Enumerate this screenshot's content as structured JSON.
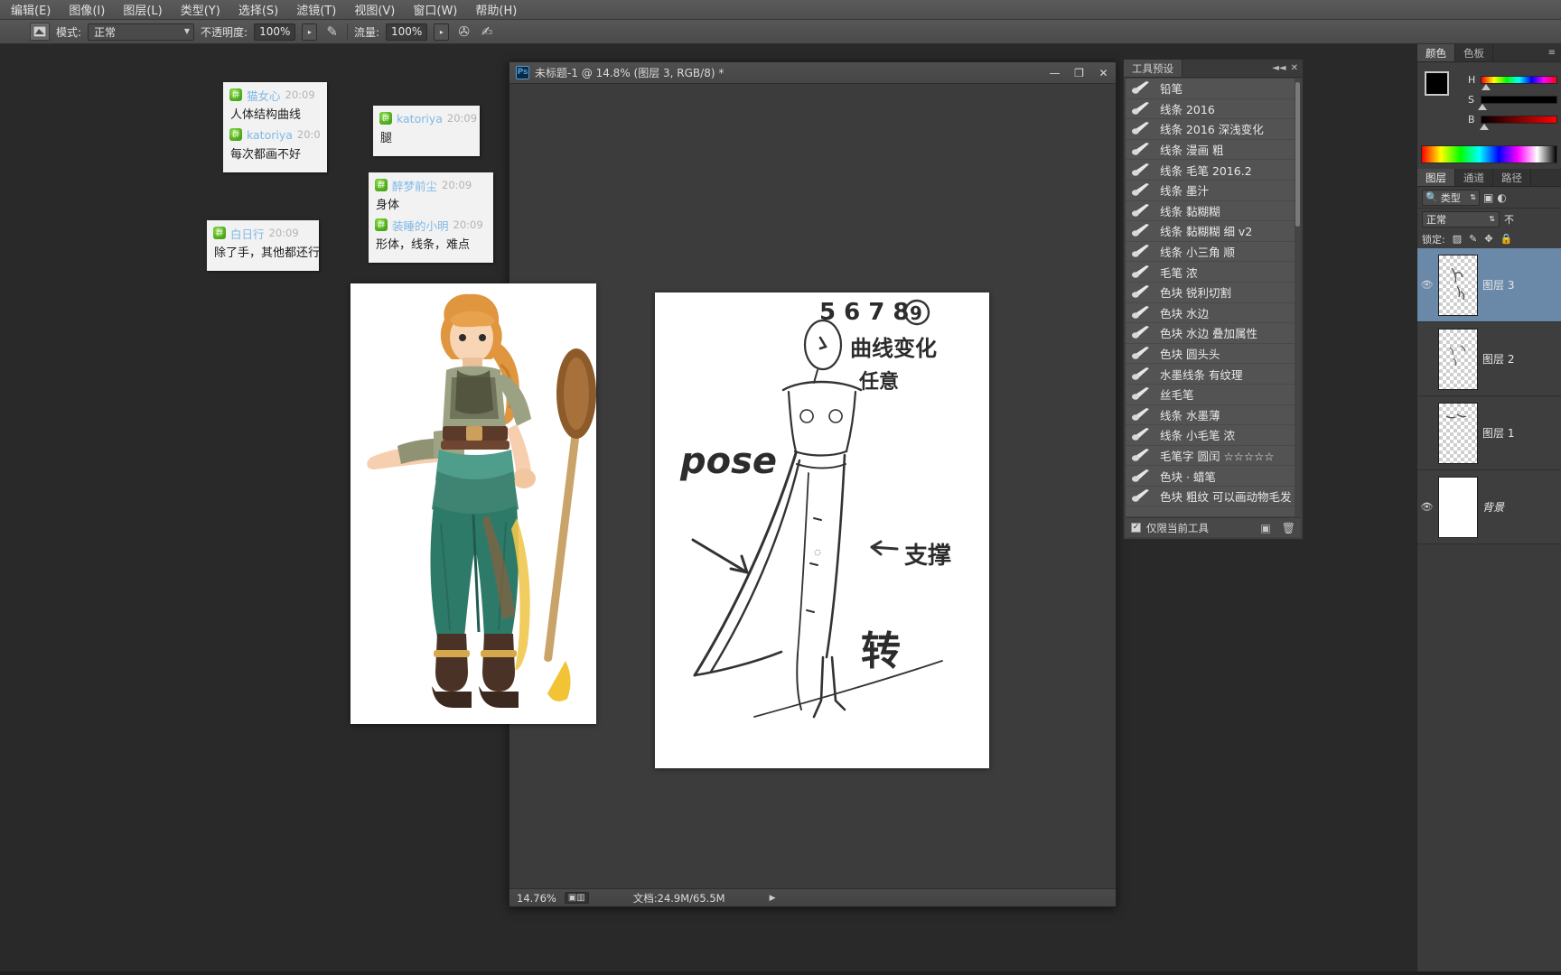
{
  "menubar": {
    "items": [
      {
        "label": "编辑(E)"
      },
      {
        "label": "图像(I)"
      },
      {
        "label": "图层(L)"
      },
      {
        "label": "类型(Y)"
      },
      {
        "label": "选择(S)"
      },
      {
        "label": "滤镜(T)"
      },
      {
        "label": "视图(V)"
      },
      {
        "label": "窗口(W)"
      },
      {
        "label": "帮助(H)"
      }
    ]
  },
  "options_bar": {
    "tool_icon": "brush-preset-icon",
    "mode_label": "模式:",
    "mode_value": "正常",
    "opacity_label": "不透明度:",
    "opacity_value": "100%",
    "airbrush_icon": "airbrush-icon",
    "flow_label": "流量:",
    "flow_value": "100%",
    "smoothing_icon": "smoothing-icon",
    "tablet_icon": "tablet-pressure-icon"
  },
  "chat": {
    "bubbles": [
      {
        "id": "bubble-1",
        "messages": [
          {
            "avatar": "group-avatar",
            "name": "猫女心",
            "time": "20:09",
            "text": "人体结构曲线"
          },
          {
            "avatar": "group-avatar",
            "name": "katoriya",
            "time": "20:0",
            "text": "每次都画不好"
          }
        ]
      },
      {
        "id": "bubble-2",
        "messages": [
          {
            "avatar": "group-avatar",
            "name": "katoriya",
            "time": "20:09",
            "text": "腿"
          }
        ]
      },
      {
        "id": "bubble-3",
        "messages": [
          {
            "avatar": "group-avatar",
            "name": "醉梦前尘",
            "time": "20:09",
            "text": "身体"
          },
          {
            "avatar": "group-avatar",
            "name": "装睡的小明",
            "time": "20:09",
            "text": "形体，线条，难点"
          }
        ]
      },
      {
        "id": "bubble-4",
        "messages": [
          {
            "avatar": "group-avatar",
            "name": "白日行",
            "time": "20:09",
            "text": "除了手，其他都还行"
          }
        ]
      }
    ]
  },
  "document_window": {
    "app_badge": "Ps",
    "title": "未标题-1 @ 14.8% (图层 3, RGB/8) *",
    "minimize_icon": "minimize-icon",
    "maximize_icon": "maximize-icon",
    "close_icon": "close-icon",
    "status": {
      "zoom": "14.76%",
      "doc_icon": "document-dimensions-icon",
      "doc_label": "文档:24.9M/65.5M",
      "more_icon": "status-more-arrow"
    }
  },
  "artwork": {
    "character_illustration": "character-illustration",
    "sketch_canvas": "pose-sketch-canvas",
    "sketch_annotations": [
      "5678 9",
      "曲线 变化",
      "任意",
      "pose",
      "支撑",
      "转"
    ]
  },
  "tool_presets_panel": {
    "tab_label": "工具预设",
    "collapse_icon": "collapse-icon",
    "close_icon": "close-icon",
    "menu_icon": "panel-menu-icon",
    "items": [
      {
        "icon": "brush-icon",
        "label": "铅笔"
      },
      {
        "icon": "brush-icon",
        "label": "线条 2016"
      },
      {
        "icon": "brush-icon",
        "label": "线条 2016 深浅变化"
      },
      {
        "icon": "brush-icon",
        "label": "线条 漫画 粗"
      },
      {
        "icon": "brush-icon",
        "label": "线条 毛笔 2016.2"
      },
      {
        "icon": "brush-icon",
        "label": "线条 墨汁"
      },
      {
        "icon": "brush-icon",
        "label": "线条 黏糊糊"
      },
      {
        "icon": "brush-icon",
        "label": "线条 黏糊糊 细 v2"
      },
      {
        "icon": "brush-icon",
        "label": "线条 小三角 顺"
      },
      {
        "icon": "brush-icon",
        "label": "毛笔 浓"
      },
      {
        "icon": "brush-icon",
        "label": "色块 锐利切割"
      },
      {
        "icon": "brush-icon",
        "label": "色块 水边"
      },
      {
        "icon": "brush-icon",
        "label": "色块 水边 叠加属性"
      },
      {
        "icon": "brush-icon",
        "label": "色块 圆头头"
      },
      {
        "icon": "brush-icon",
        "label": "水墨线条 有纹理"
      },
      {
        "icon": "brush-icon",
        "label": "丝毛笔"
      },
      {
        "icon": "brush-icon",
        "label": "线条 水墨薄"
      },
      {
        "icon": "brush-icon",
        "label": "线条 小毛笔 浓"
      },
      {
        "icon": "brush-icon",
        "label": "毛笔字 圆闰 ☆☆☆☆☆"
      },
      {
        "icon": "brush-icon",
        "label": "色块 · 蜡笔"
      },
      {
        "icon": "brush-icon",
        "label": "色块 粗纹 可以画动物毛发"
      }
    ],
    "footer": {
      "checkbox_checked": "✓",
      "checkbox_label": "仅限当前工具",
      "new_preset_icon": "new-preset-icon",
      "delete_icon": "trash-icon"
    }
  },
  "color_panel": {
    "tabs": [
      {
        "label": "颜色",
        "active": true
      },
      {
        "label": "色板",
        "active": false
      }
    ],
    "foreground_color": "#000000",
    "background_color": "#c8c8c8",
    "sliders": [
      {
        "channel": "H"
      },
      {
        "channel": "S"
      },
      {
        "channel": "B"
      }
    ],
    "menu_icon": "panel-menu-icon"
  },
  "layers_panel": {
    "tabs": [
      {
        "label": "图层",
        "active": true
      },
      {
        "label": "通道",
        "active": false
      },
      {
        "label": "路径",
        "active": false
      }
    ],
    "filter": {
      "search_icon": "search-icon",
      "value": "类型",
      "chevron": "⇅"
    },
    "filter_icons": [
      "image-filter-icon",
      "adjustment-filter-icon"
    ],
    "blend_mode": "正常",
    "opacity_label": "不",
    "lock_label": "锁定:",
    "lock_icons": [
      "lock-transparent-icon",
      "lock-image-icon",
      "lock-position-icon",
      "lock-all-icon"
    ],
    "layers": [
      {
        "name": "图层 3",
        "visible": true,
        "selected": true,
        "thumb": "transparent-sketch"
      },
      {
        "name": "图层 2",
        "visible": false,
        "selected": false,
        "thumb": "transparent-sketch"
      },
      {
        "name": "图层 1",
        "visible": false,
        "selected": false,
        "thumb": "transparent-sketch"
      },
      {
        "name": "背景",
        "visible": true,
        "selected": false,
        "thumb": "white-opaque"
      }
    ]
  },
  "colors": {
    "app_bg": "#292929",
    "panel_bg": "#3f3f3f",
    "preset_row_bg": "#535353",
    "selection_blue": "#6a89a8",
    "chat_name_blue": "#7fb8e6",
    "avatar_green": "#4aa518"
  }
}
